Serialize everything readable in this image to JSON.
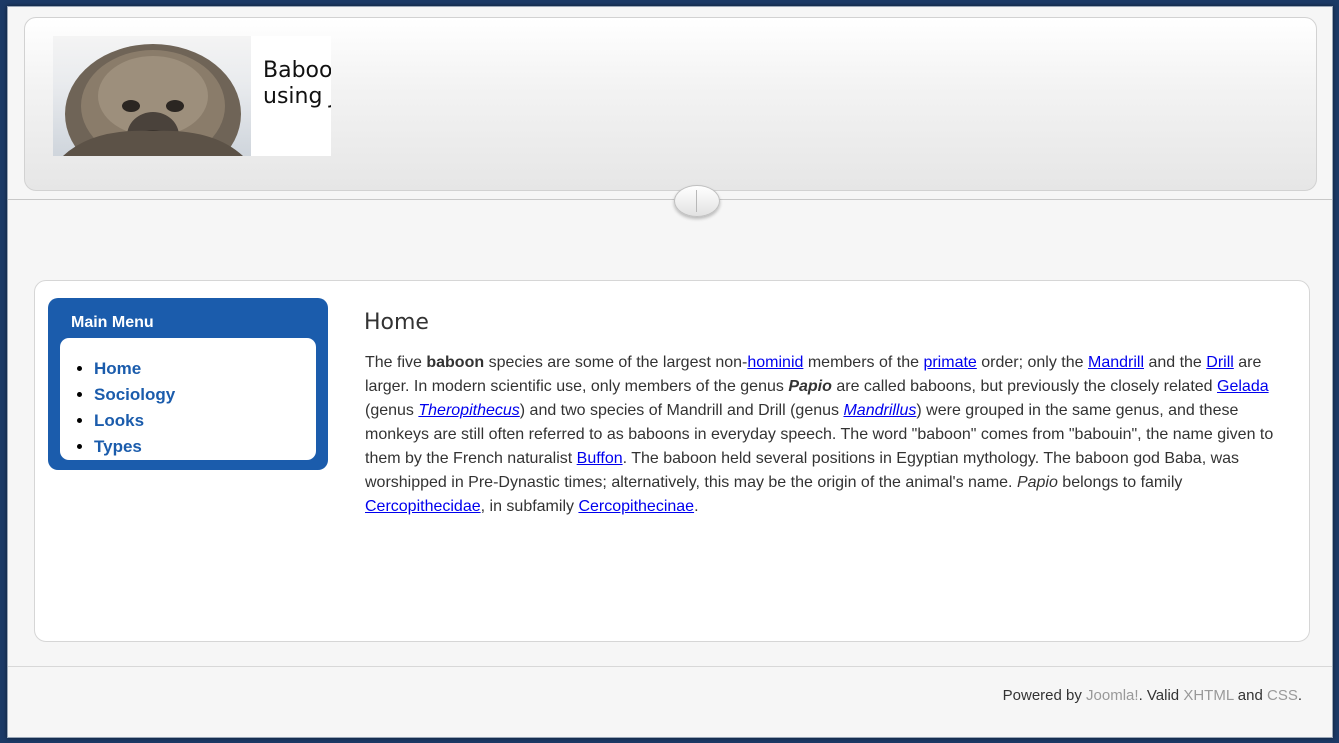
{
  "header": {
    "logo_line1": "Baboon Website",
    "logo_line2": "using Joomla!"
  },
  "menu": {
    "title": "Main Menu",
    "items": [
      {
        "label": "Home"
      },
      {
        "label": "Sociology"
      },
      {
        "label": "Looks"
      },
      {
        "label": "Types"
      }
    ]
  },
  "article": {
    "title": "Home",
    "t1": "The five ",
    "b1": "baboon",
    "t2": " species are some of the largest non-",
    "link_hominid": "hominid",
    "t3": " members of the ",
    "link_primate": "primate",
    "t4": " order; only the ",
    "link_mandrill": "Mandrill",
    "t5": " and the ",
    "link_drill": "Drill",
    "t6": " are larger. In modern scientific use, only members of the genus ",
    "bi_papio": "Papio",
    "t7": " are called baboons, but previously the closely related ",
    "link_gelada": "Gelada",
    "t8": " (genus ",
    "link_theropithecus": "Theropithecus",
    "t9": ") and two species of Mandrill and Drill (genus ",
    "link_mandrillus": "Mandrillus",
    "t10": ") were grouped in the same genus, and these monkeys are still often referred to as baboons in everyday speech. The word \"baboon\" comes from \"babouin\", the name given to them by the French naturalist ",
    "link_buffon": "Buffon",
    "t11": ". The baboon held several positions in Egyptian mythology. The baboon god Baba, was worshipped in Pre-Dynastic times; alternatively, this may be the origin of the animal's name. ",
    "i_papio": "Papio",
    "t12": " belongs to family ",
    "link_cercopithecidae": "Cercopithecidae",
    "t13": ", in subfamily ",
    "link_cercopithecinae": "Cercopithecinae",
    "t14": "."
  },
  "footer": {
    "t1": "Powered by ",
    "link_joomla": "Joomla!",
    "t2": ". Valid ",
    "link_xhtml": "XHTML",
    "t3": " and ",
    "link_css": "CSS",
    "t4": "."
  },
  "colors": {
    "menu_blue": "#1b5cac",
    "link_blue": "#0000ee",
    "frame_navy": "#1c3a66"
  }
}
